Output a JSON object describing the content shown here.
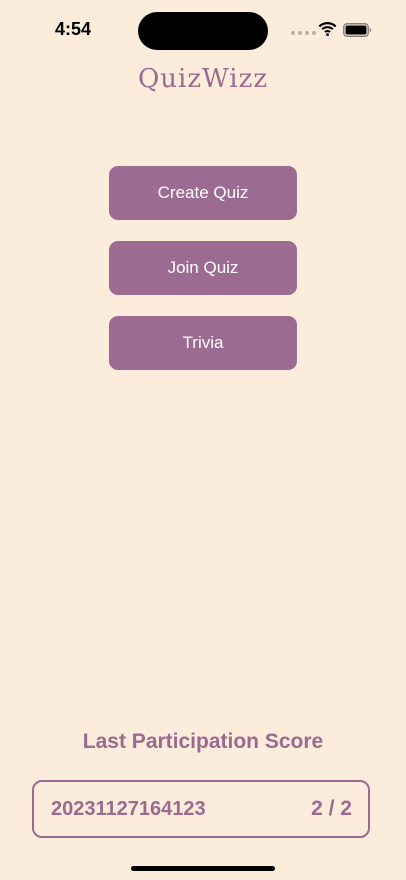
{
  "status_bar": {
    "time": "4:54"
  },
  "app": {
    "title": "QuizWizz"
  },
  "menu": {
    "create_label": "Create Quiz",
    "join_label": "Join Quiz",
    "trivia_label": "Trivia"
  },
  "score": {
    "heading": "Last Participation Score",
    "quiz_id": "20231127164123",
    "value": "2 / 2"
  },
  "colors": {
    "background": "#fcecdb",
    "accent": "#9b6b91",
    "button_text": "#ffffff"
  },
  "icons": [
    "signal-icon",
    "wifi-icon",
    "battery-icon"
  ]
}
